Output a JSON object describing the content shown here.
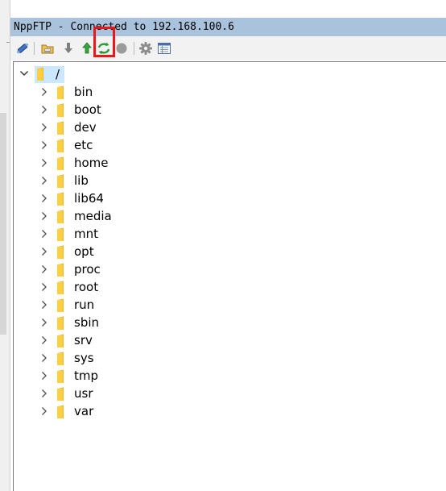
{
  "window": {
    "title": "NppFTP - Connected to 192.168.100.6"
  },
  "toolbar": {
    "buttons": [
      {
        "name": "connect-icon",
        "label": "Connect"
      },
      {
        "name": "open-folder-icon",
        "label": "Open directory"
      },
      {
        "name": "download-icon",
        "label": "Download"
      },
      {
        "name": "upload-icon",
        "label": "Upload"
      },
      {
        "name": "refresh-icon",
        "label": "Refresh"
      },
      {
        "name": "stop-icon",
        "label": "Abort"
      },
      {
        "name": "settings-icon",
        "label": "Settings"
      },
      {
        "name": "message-window-icon",
        "label": "Show message window"
      }
    ],
    "highlighted": "refresh-icon"
  },
  "tree": {
    "root": {
      "label": "/",
      "expanded": true,
      "selected": true
    },
    "children": [
      {
        "label": "bin"
      },
      {
        "label": "boot"
      },
      {
        "label": "dev"
      },
      {
        "label": "etc"
      },
      {
        "label": "home"
      },
      {
        "label": "lib"
      },
      {
        "label": "lib64"
      },
      {
        "label": "media"
      },
      {
        "label": "mnt"
      },
      {
        "label": "opt"
      },
      {
        "label": "proc"
      },
      {
        "label": "root"
      },
      {
        "label": "run"
      },
      {
        "label": "sbin"
      },
      {
        "label": "srv"
      },
      {
        "label": "sys"
      },
      {
        "label": "tmp"
      },
      {
        "label": "usr"
      },
      {
        "label": "var"
      }
    ]
  },
  "colors": {
    "titlebar": "#a9c3dc",
    "selection": "#cce8ff",
    "folder": "#ffcf3f",
    "highlight_box": "#e8171c"
  }
}
